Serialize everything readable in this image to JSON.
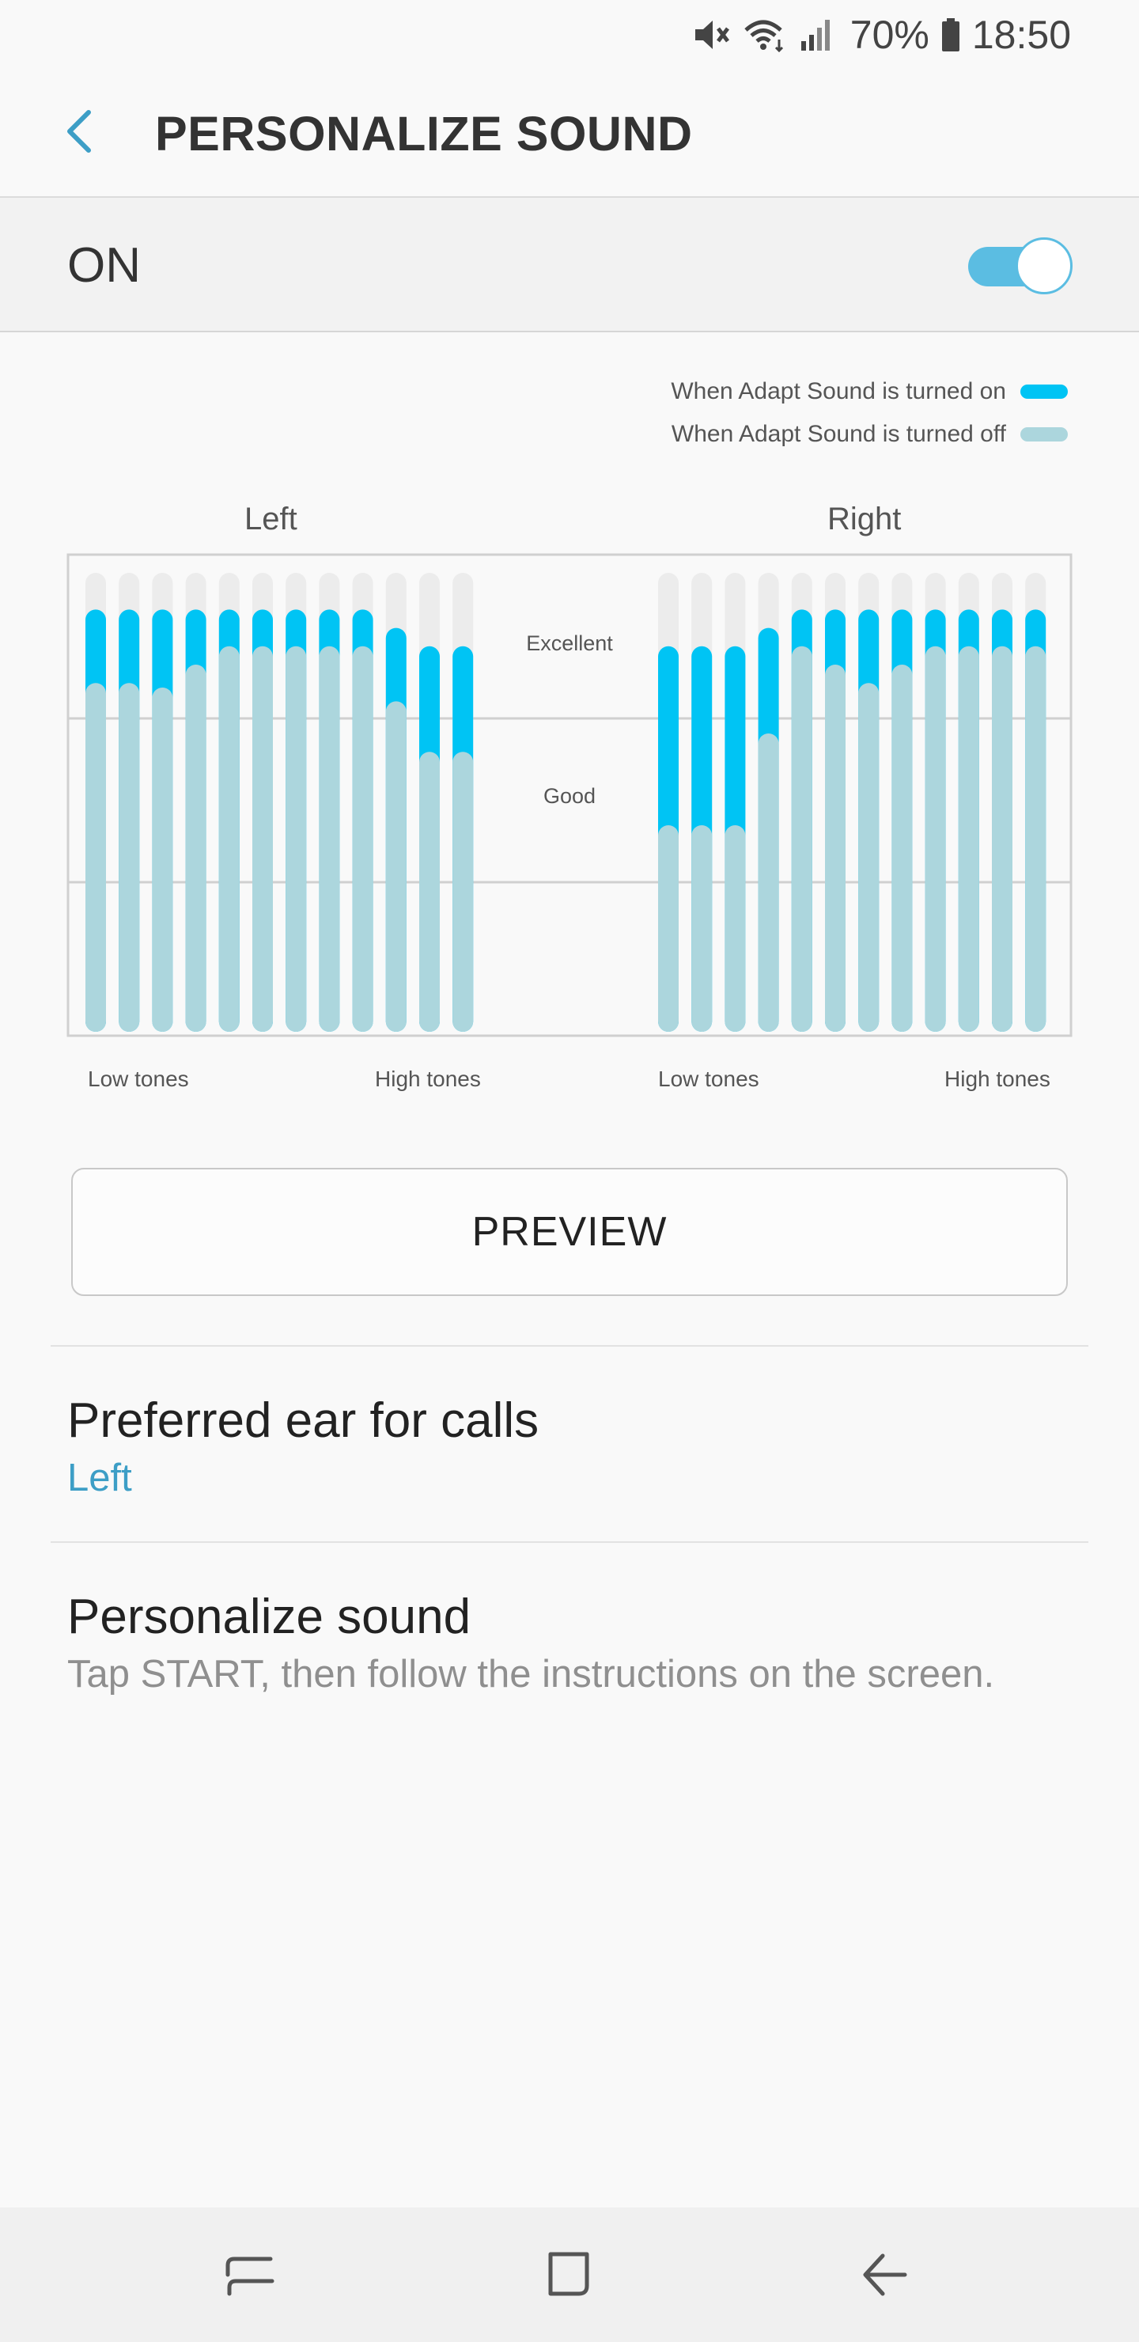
{
  "status_bar": {
    "icons": [
      "mute-icon",
      "wifi-icon",
      "signal-icon",
      "battery-icon"
    ],
    "battery": "70%",
    "time": "18:50"
  },
  "app_bar": {
    "back_icon": "chevron-left-icon",
    "title": "PERSONALIZE SOUND"
  },
  "master_switch": {
    "label": "ON",
    "checked": true
  },
  "legend": {
    "on_label": "When Adapt Sound is turned on",
    "off_label": "When Adapt Sound is turned off"
  },
  "colors": {
    "on": "#00c4f4",
    "off": "#acd6dd",
    "empty": "#ececec",
    "accent": "#3d9ec6",
    "toggle": "#5bbde2"
  },
  "chart_data": {
    "type": "bar",
    "scale_max": 1.0,
    "levels": [
      "Excellent",
      "Good"
    ],
    "charts": [
      {
        "title": "Left",
        "x_start_label": "Low tones",
        "x_end_label": "High tones",
        "bands": 12,
        "series": [
          {
            "name": "When Adapt Sound is turned on",
            "values": [
              0.92,
              0.92,
              0.92,
              0.92,
              0.92,
              0.92,
              0.92,
              0.92,
              0.92,
              0.88,
              0.84,
              0.84
            ]
          },
          {
            "name": "When Adapt Sound is turned off",
            "values": [
              0.76,
              0.76,
              0.75,
              0.8,
              0.84,
              0.84,
              0.84,
              0.84,
              0.84,
              0.72,
              0.61,
              0.61
            ]
          }
        ]
      },
      {
        "title": "Right",
        "x_start_label": "Low tones",
        "x_end_label": "High tones",
        "bands": 12,
        "series": [
          {
            "name": "When Adapt Sound is turned on",
            "values": [
              0.84,
              0.84,
              0.84,
              0.88,
              0.92,
              0.92,
              0.92,
              0.92,
              0.92,
              0.92,
              0.92,
              0.92
            ]
          },
          {
            "name": "When Adapt Sound is turned off",
            "values": [
              0.45,
              0.45,
              0.45,
              0.65,
              0.84,
              0.8,
              0.76,
              0.8,
              0.84,
              0.84,
              0.84,
              0.84
            ]
          }
        ]
      }
    ]
  },
  "preview_button": "PREVIEW",
  "settings": [
    {
      "title": "Preferred ear for calls",
      "subtitle": "Left"
    },
    {
      "title": "Personalize sound",
      "subtitle": "Tap START, then follow the instructions on the screen."
    }
  ],
  "nav_bar": {
    "icons": [
      "recents-icon",
      "home-icon",
      "back-icon"
    ]
  }
}
